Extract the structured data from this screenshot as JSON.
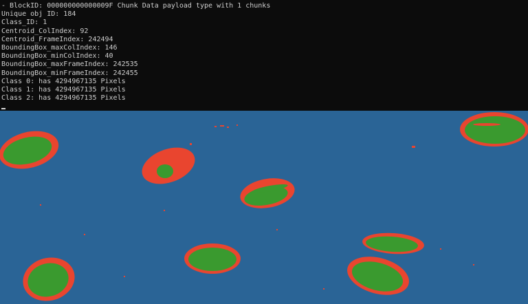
{
  "console": {
    "lines": [
      "- BlockID: 000000000000009F Chunk Data payload type with 1 chunks",
      "Unique obj ID: 184",
      "Class_ID: 1",
      "Centroid_ColIndex: 92",
      "Centroid_FrameIndex: 242494",
      "BoundingBox_maxColIndex: 146",
      "BoundingBox_minColIndex: 40",
      "BoundingBox_maxFrameIndex: 242535",
      "BoundingBox_minFrameIndex: 242455",
      "Class 0: has 4294967135 Pixels",
      "Class 1: has 4294967135 Pixels",
      "Class 2: has 4294967135 Pixels"
    ]
  },
  "colors": {
    "background_class": "#2a6496",
    "edge_class": "#e9452f",
    "object_class": "#3a9a2f",
    "console_bg": "#0c0c0c",
    "console_text": "#cfcfcf"
  }
}
